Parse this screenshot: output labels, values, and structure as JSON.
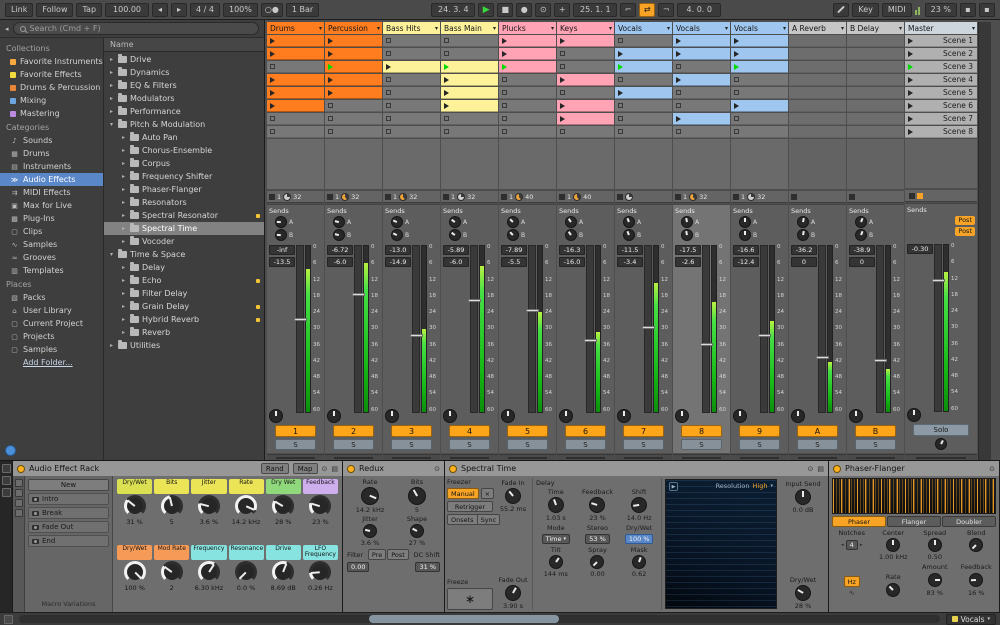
{
  "transport": {
    "link": "Link",
    "follow": "Follow",
    "tap": "Tap",
    "tempo": "100.00",
    "timesig": "4 / 4",
    "groove": "100%",
    "quantize": "1 Bar",
    "position": "24. 3. 4",
    "loop_start": "25. 1. 1",
    "loop_length": "4. 0. 0",
    "key": "Key",
    "midi": "MIDI",
    "cpu": "23 %"
  },
  "browser": {
    "search_placeholder": "Search (Cmd + F)",
    "collections_label": "Collections",
    "collections": [
      {
        "label": "Favorite Instruments",
        "color": "#f7a940"
      },
      {
        "label": "Favorite Effects",
        "color": "#f2d93e"
      },
      {
        "label": "Drums & Percussion",
        "color": "#e8863c"
      },
      {
        "label": "Mixing",
        "color": "#6ea6e0"
      },
      {
        "label": "Mastering",
        "color": "#b98ae0"
      }
    ],
    "categories_label": "Categories",
    "categories": [
      {
        "label": "Sounds",
        "icon": "♪"
      },
      {
        "label": "Drums",
        "icon": "▦"
      },
      {
        "label": "Instruments",
        "icon": "▤"
      },
      {
        "label": "Audio Effects",
        "icon": "≫",
        "selected": true
      },
      {
        "label": "MIDI Effects",
        "icon": "⇉"
      },
      {
        "label": "Max for Live",
        "icon": "▣"
      },
      {
        "label": "Plug-Ins",
        "icon": "▩"
      },
      {
        "label": "Clips",
        "icon": "▢"
      },
      {
        "label": "Samples",
        "icon": "∿"
      },
      {
        "label": "Grooves",
        "icon": "≈"
      },
      {
        "label": "Templates",
        "icon": "▥"
      }
    ],
    "places_label": "Places",
    "places": [
      {
        "label": "Packs",
        "icon": "▧"
      },
      {
        "label": "User Library",
        "icon": "⌂"
      },
      {
        "label": "Current Project",
        "icon": "▢"
      },
      {
        "label": "Projects",
        "icon": "▢"
      },
      {
        "label": "Samples",
        "icon": "▢"
      },
      {
        "label": "Add Folder...",
        "icon": "",
        "link": true
      }
    ],
    "tree_header": "Name",
    "tree": [
      {
        "label": "Drive",
        "depth": 0,
        "exp": false
      },
      {
        "label": "Dynamics",
        "depth": 0,
        "exp": false
      },
      {
        "label": "EQ & Filters",
        "depth": 0,
        "exp": false
      },
      {
        "label": "Modulators",
        "depth": 0,
        "exp": false
      },
      {
        "label": "Performance",
        "depth": 0,
        "exp": false
      },
      {
        "label": "Pitch & Modulation",
        "depth": 0,
        "exp": true
      },
      {
        "label": "Auto Pan",
        "depth": 1
      },
      {
        "label": "Chorus-Ensemble",
        "depth": 1
      },
      {
        "label": "Corpus",
        "depth": 1
      },
      {
        "label": "Frequency Shifter",
        "depth": 1
      },
      {
        "label": "Phaser-Flanger",
        "depth": 1
      },
      {
        "label": "Resonators",
        "depth": 1
      },
      {
        "label": "Spectral Resonator",
        "depth": 1,
        "fav": true
      },
      {
        "label": "Spectral Time",
        "depth": 1,
        "selected": true
      },
      {
        "label": "Vocoder",
        "depth": 1
      },
      {
        "label": "Time & Space",
        "depth": 0,
        "exp": true
      },
      {
        "label": "Delay",
        "depth": 1
      },
      {
        "label": "Echo",
        "depth": 1,
        "fav": true
      },
      {
        "label": "Filter Delay",
        "depth": 1
      },
      {
        "label": "Grain Delay",
        "depth": 1,
        "fav": true
      },
      {
        "label": "Hybrid Reverb",
        "depth": 1,
        "fav": true
      },
      {
        "label": "Reverb",
        "depth": 1
      },
      {
        "label": "Utilities",
        "depth": 0,
        "exp": false
      }
    ]
  },
  "session": {
    "sends_label": "Sends",
    "send_letters": [
      "A",
      "B"
    ],
    "post_label": "Post",
    "solo_label": "S",
    "db_scale": [
      "0",
      "6",
      "12",
      "18",
      "24",
      "30",
      "36",
      "42",
      "48",
      "54",
      "60"
    ],
    "playing_scene": 3,
    "scenes": [
      "Scene 1",
      "Scene 2",
      "Scene 3",
      "Scene 4",
      "Scene 5",
      "Scene 6",
      "Scene 7",
      "Scene 8"
    ],
    "tracks": [
      {
        "name": "Drums",
        "color": "#ff7d1e",
        "id": "1",
        "vol": "-inf",
        "peak": "-13.5",
        "meter": 0.86,
        "fader": 0.55,
        "status": {
          "left": "1",
          "right": "32",
          "pie": "gray"
        }
      },
      {
        "name": "Percussion",
        "color": "#ff7d1e",
        "id": "2",
        "vol": "-6.72",
        "peak": "-6.0",
        "meter": 0.9,
        "fader": 0.7,
        "status": {
          "left": "1",
          "right": "32",
          "pie": "orange"
        }
      },
      {
        "name": "Bass Hits",
        "color": "#fdf29a",
        "id": "3",
        "vol": "-13.0",
        "peak": "-14.9",
        "meter": 0.5,
        "fader": 0.45,
        "status": {
          "left": "1",
          "right": "32",
          "pie": "orange"
        }
      },
      {
        "name": "Bass Main",
        "color": "#fdf29a",
        "id": "4",
        "vol": "-5.89",
        "peak": "-6.0",
        "meter": 0.88,
        "fader": 0.66,
        "status": {
          "left": "1",
          "right": "32",
          "pie": "gray"
        }
      },
      {
        "name": "Plucks",
        "color": "#ffa3b5",
        "id": "5",
        "vol": "-7.89",
        "peak": "-5.5",
        "meter": 0.6,
        "fader": 0.6,
        "status": {
          "left": "1",
          "right": "40",
          "pie": "orange"
        }
      },
      {
        "name": "Keys",
        "color": "#ffa3b5",
        "id": "6",
        "vol": "-16.3",
        "peak": "-16.0",
        "meter": 0.48,
        "fader": 0.42,
        "status": {
          "left": "1",
          "right": "40",
          "pie": "orange"
        }
      },
      {
        "name": "Vocals",
        "color": "#9ec6ee",
        "id": "7",
        "vol": "-11.5",
        "peak": "-3.4",
        "meter": 0.78,
        "fader": 0.5,
        "status": {
          "left": "",
          "right": "",
          "pie": "gray"
        }
      },
      {
        "name": "Vocals",
        "color": "#9ec6ee",
        "id": "8",
        "vol": "-17.5",
        "peak": "-2.6",
        "meter": 0.66,
        "fader": 0.4,
        "selected": true,
        "status": {
          "left": "1",
          "right": "32",
          "pie": "orange"
        }
      },
      {
        "name": "Vocals",
        "color": "#9ec6ee",
        "id": "9",
        "vol": "-16.6",
        "peak": "-12.4",
        "meter": 0.55,
        "fader": 0.45,
        "status": {
          "left": "1",
          "right": "32",
          "pie": "gray"
        }
      },
      {
        "name": "A Reverb",
        "color": "#c6c6c6",
        "id": "A",
        "kind": "return",
        "vol": "-36.2",
        "peak": "0",
        "meter": 0.3,
        "fader": 0.32
      },
      {
        "name": "B Delay",
        "color": "#c6c6c6",
        "id": "B",
        "kind": "return",
        "vol": "-38.9",
        "peak": "0",
        "meter": 0.26,
        "fader": 0.3
      },
      {
        "name": "Master",
        "color": "#cdd6dc",
        "id": "Solo",
        "kind": "master",
        "vol": "-0.30",
        "peak": "",
        "meter": 0.84,
        "fader": 0.78
      }
    ],
    "clips": [
      [
        "c",
        "c",
        null,
        "c",
        "c",
        "c",
        null,
        null
      ],
      [
        "c",
        "c",
        "p",
        "c",
        "c",
        null,
        null,
        null
      ],
      [
        null,
        null,
        "c",
        null,
        null,
        null,
        null,
        null
      ],
      [
        null,
        null,
        "p",
        "c",
        "c",
        "c",
        null,
        null
      ],
      [
        "c",
        "c",
        "p",
        null,
        null,
        null,
        null,
        null
      ],
      [
        "c",
        null,
        null,
        "c",
        null,
        "c",
        "c",
        null
      ],
      [
        null,
        "c",
        "p",
        null,
        "c",
        null,
        null,
        null
      ],
      [
        "c",
        "c",
        null,
        "c",
        null,
        null,
        "c",
        null
      ],
      [
        "c",
        "c",
        "p",
        null,
        null,
        "c",
        null,
        null
      ]
    ]
  },
  "devices": {
    "rack": {
      "title": "Audio Effect Rack",
      "rand": "Rand",
      "map": "Map",
      "new_btn": "New",
      "variations": [
        "Intro",
        "Break",
        "Fade Out",
        "End"
      ],
      "variations_label": "Macro Variations",
      "macros": [
        {
          "label": "Dry/Wet",
          "value": "31 %",
          "color": "#dbe052",
          "pct": 31
        },
        {
          "label": "Bits",
          "value": "5",
          "color": "#ece457",
          "pct": 45
        },
        {
          "label": "Jitter",
          "value": "3.6 %",
          "color": "#ece457",
          "pct": 22
        },
        {
          "label": "Rate",
          "value": "14.2 kHz",
          "color": "#ece457",
          "pct": 92
        },
        {
          "label": "Dry Wet",
          "value": "28 %",
          "color": "#8fd97c",
          "pct": 28
        },
        {
          "label": "Feedback",
          "value": "23 %",
          "color": "#cfaeee",
          "pct": 23
        },
        {
          "label": "Dry/Wet",
          "value": "100 %",
          "color": "#f59a57",
          "pct": 100
        },
        {
          "label": "Mod Rate",
          "value": "2",
          "color": "#f59a57",
          "pct": 30
        },
        {
          "label": "Frequency",
          "value": "6.30 kHz",
          "color": "#86e3df",
          "pct": 62
        },
        {
          "label": "Resonance",
          "value": "0.0 %",
          "color": "#86e3df",
          "pct": 0
        },
        {
          "label": "Drive",
          "value": "8.69 dB",
          "color": "#86e3df",
          "pct": 58
        },
        {
          "label": "LFO Frequency",
          "value": "0.26 Hz",
          "color": "#86e3df",
          "pct": 15
        }
      ]
    },
    "redux": {
      "title": "Redux",
      "rate_label": "Rate",
      "rate_value": "14.2 kHz",
      "jitter_label": "Jitter",
      "jitter_value": "3.6 %",
      "bits_label": "Bits",
      "bits_value": "5",
      "shape_label": "Shape",
      "shape_value": "27 %",
      "filter_label": "Filter",
      "pre": "Pre",
      "post": "Post",
      "dc_label": "DC Shift",
      "dc_value": "0.00",
      "wet_value": "31 %"
    },
    "spectral": {
      "title": "Spectral Time",
      "freezer_label": "Freezer",
      "manual": "Manual",
      "retrigger": "Retrigger",
      "onsets": "Onsets",
      "sync": "Sync",
      "fade_in_label": "Fade In",
      "fade_in_value": "55.2 ms",
      "fade_out_label": "Fade Out",
      "fade_out_value": "3.90 s",
      "freeze_label": "Freeze",
      "freeze_glyph": "∗",
      "delay_label": "Delay",
      "time_label": "Time",
      "time_value": "1.03 s",
      "feedback_label": "Feedback",
      "feedback_value": "23 %",
      "shift_label": "Shift",
      "shift_value": "14.0 Hz",
      "mode_label": "Mode",
      "mode_value": "Time",
      "stereo_label": "Stereo",
      "stereo_value": "53 %",
      "drywet_label": "Dry/Wet",
      "drywet_value": "100 %",
      "tilt_label": "Tilt",
      "tilt_value": "144 ms",
      "spray_label": "Spray",
      "spray_value": "0.00",
      "mask_label": "Mask",
      "mask_value": "0.62",
      "resolution_label": "Resolution",
      "resolution_value": "High",
      "input_send_label": "Input Send",
      "input_send_value": "0.0 dB",
      "out_drywet_label": "Dry/Wet",
      "out_drywet_value": "28 %"
    },
    "phaser": {
      "title": "Phaser-Flanger",
      "tabs": [
        "Phaser",
        "Flanger",
        "Doubler"
      ],
      "active_tab": "Phaser",
      "notches_label": "Notches",
      "notches_value": "4",
      "center_label": "Center",
      "center_value": "1.00 kHz",
      "spread_label": "Spread",
      "spread_value": "0.50",
      "blend_label": "Blend",
      "hz": "Hz",
      "rate_label": "Rate",
      "amount_label": "Amount",
      "amount_value": "83 %",
      "feedback_label": "Feedback",
      "feedback_value": "16 %"
    }
  },
  "statusbar": {
    "selected_track": "Vocals"
  }
}
